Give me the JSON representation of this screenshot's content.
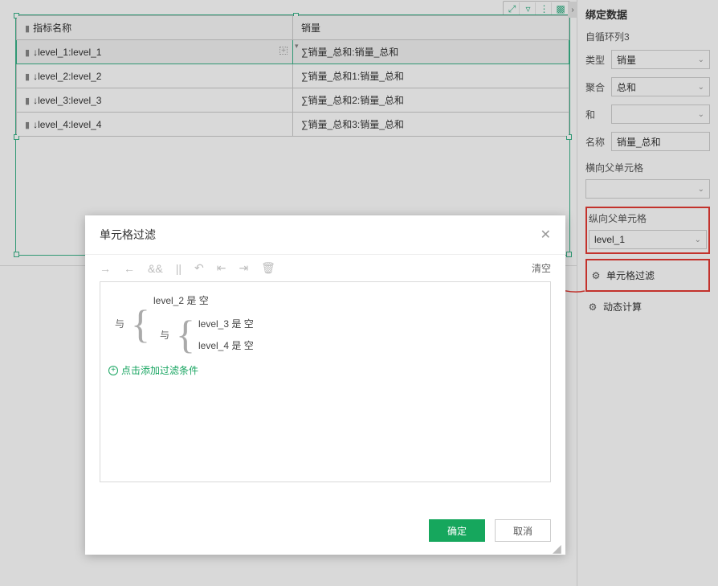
{
  "table": {
    "headers": [
      "指标名称",
      "销量"
    ],
    "rows": [
      {
        "left": "↓level_1:level_1",
        "right": "∑销量_总和:销量_总和"
      },
      {
        "left": "↓level_2:level_2",
        "right": "∑销量_总和1:销量_总和"
      },
      {
        "left": "↓level_3:level_3",
        "right": "∑销量_总和2:销量_总和"
      },
      {
        "left": "↓level_4:level_4",
        "right": "∑销量_总和3:销量_总和"
      }
    ]
  },
  "miniToolbar": {
    "expand": "⤢",
    "filter": "▿",
    "more": "⋮",
    "palette": "▩"
  },
  "sidebar": {
    "title": "绑定数据",
    "selfLoop": "自循环列3",
    "typeLabel": "类型",
    "typeValue": "销量",
    "aggLabel": "聚合",
    "aggValue": "总和",
    "andLabel": "和",
    "andValue": "",
    "nameLabel": "名称",
    "nameValue": "销量_总和",
    "hParentLabel": "横向父单元格",
    "hParentValue": "",
    "vParentLabel": "纵向父单元格",
    "vParentValue": "level_1",
    "cellFilter": "单元格过滤",
    "dynCalc": "动态计算"
  },
  "dialog": {
    "title": "单元格过滤",
    "clear": "清空",
    "op1": "与",
    "op2": "与",
    "cond1": "level_2 是 空",
    "cond2": "level_3 是 空",
    "cond3": "level_4 是 空",
    "addLink": "点击添加过滤条件",
    "ok": "确定",
    "cancel": "取消"
  },
  "icons": {
    "arrowRight": "→",
    "arrowLeft": "←",
    "and": "&&",
    "or": "||",
    "undo": "↶",
    "indent": "⇤",
    "outdent": "⇥",
    "trash": "🗑"
  }
}
